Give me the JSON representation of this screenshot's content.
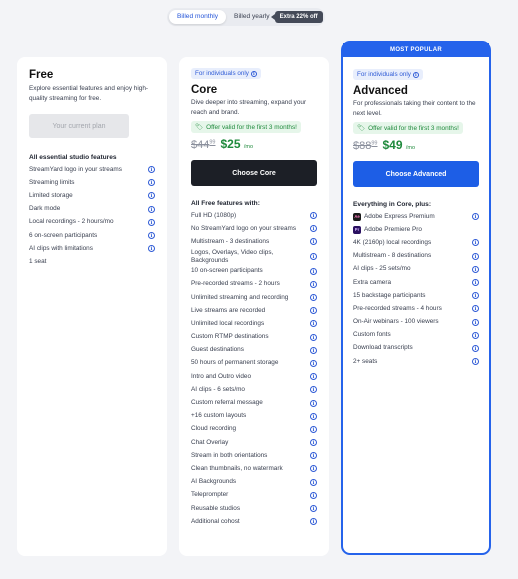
{
  "toggle": {
    "monthly": "Billed monthly",
    "yearly": "Billed yearly",
    "badge": "Extra 22% off"
  },
  "free": {
    "name": "Free",
    "description": "Explore essential features and enjoy high-quality streaming for free.",
    "cta": "Your current plan",
    "features_heading": "All essential studio features",
    "features": [
      {
        "label": "StreamYard logo in your streams",
        "info": true
      },
      {
        "label": "Streaming limits",
        "info": true
      },
      {
        "label": "Limited storage",
        "info": true
      },
      {
        "label": "Dark mode",
        "info": true
      },
      {
        "label": "Local recordings - 2 hours/mo",
        "info": true
      },
      {
        "label": "6 on-screen participants",
        "info": true
      },
      {
        "label": "AI clips with limitations",
        "info": true
      },
      {
        "label": "1 seat",
        "info": false
      }
    ]
  },
  "core": {
    "tag": "For individuals only",
    "name": "Core",
    "description": "Dive deeper into streaming, expand your reach and brand.",
    "offer": "Offer valid for the first 3 months!",
    "old_price": "$44",
    "old_cents": "99",
    "new_price": "$25",
    "per": "/mo",
    "cta": "Choose Core",
    "features_heading": "All Free features with:",
    "features": [
      {
        "label": "Full HD (1080p)",
        "info": true
      },
      {
        "label": "No StreamYard logo on your streams",
        "info": true
      },
      {
        "label": "Multistream - 3 destinations",
        "info": true
      },
      {
        "label": "Logos, Overlays, Video clips, Backgrounds",
        "info": true
      },
      {
        "label": "10 on-screen participants",
        "info": true
      },
      {
        "label": "Pre-recorded streams - 2 hours",
        "info": true
      },
      {
        "label": "Unlimited streaming and recording",
        "info": true
      },
      {
        "label": "Live streams are recorded",
        "info": true
      },
      {
        "label": "Unlimited local recordings",
        "info": true
      },
      {
        "label": "Custom RTMP destinations",
        "info": true
      },
      {
        "label": "Guest destinations",
        "info": true
      },
      {
        "label": "50 hours of permanent storage",
        "info": true
      },
      {
        "label": "Intro and Outro video",
        "info": true
      },
      {
        "label": "AI clips - 6 sets/mo",
        "info": true
      },
      {
        "label": "Custom referral message",
        "info": true
      },
      {
        "label": "+16 custom layouts",
        "info": true
      },
      {
        "label": "Cloud recording",
        "info": true
      },
      {
        "label": "Chat Overlay",
        "info": true
      },
      {
        "label": "Stream in both orientations",
        "info": true
      },
      {
        "label": "Clean thumbnails, no watermark",
        "info": true
      },
      {
        "label": "AI Backgrounds",
        "info": true
      },
      {
        "label": "Teleprompter",
        "info": true
      },
      {
        "label": "Reusable studios",
        "info": true
      },
      {
        "label": "Additional cohost",
        "info": true
      }
    ]
  },
  "advanced": {
    "banner": "MOST POPULAR",
    "tag": "For individuals only",
    "name": "Advanced",
    "description": "For professionals taking their content to the next level.",
    "offer": "Offer valid for the first 3 months!",
    "old_price": "$88",
    "old_cents": "99",
    "new_price": "$49",
    "per": "/mo",
    "cta": "Choose Advanced",
    "features_heading": "Everything in Core, plus:",
    "features": [
      {
        "label": "Adobe Express Premium",
        "info": true,
        "icon": "Ae"
      },
      {
        "label": "Adobe Premiere Pro",
        "info": false,
        "icon": "Pr"
      },
      {
        "label": "4K (2160p) local recordings",
        "info": true
      },
      {
        "label": "Multistream - 8 destinations",
        "info": true
      },
      {
        "label": "AI clips - 25 sets/mo",
        "info": true
      },
      {
        "label": "Extra camera",
        "info": true
      },
      {
        "label": "15 backstage participants",
        "info": true
      },
      {
        "label": "Pre-recorded streams - 4 hours",
        "info": true
      },
      {
        "label": "On-Air webinars - 100 viewers",
        "info": true
      },
      {
        "label": "Custom fonts",
        "info": true
      },
      {
        "label": "Download transcripts",
        "info": true
      },
      {
        "label": "2+ seats",
        "info": true
      }
    ]
  }
}
